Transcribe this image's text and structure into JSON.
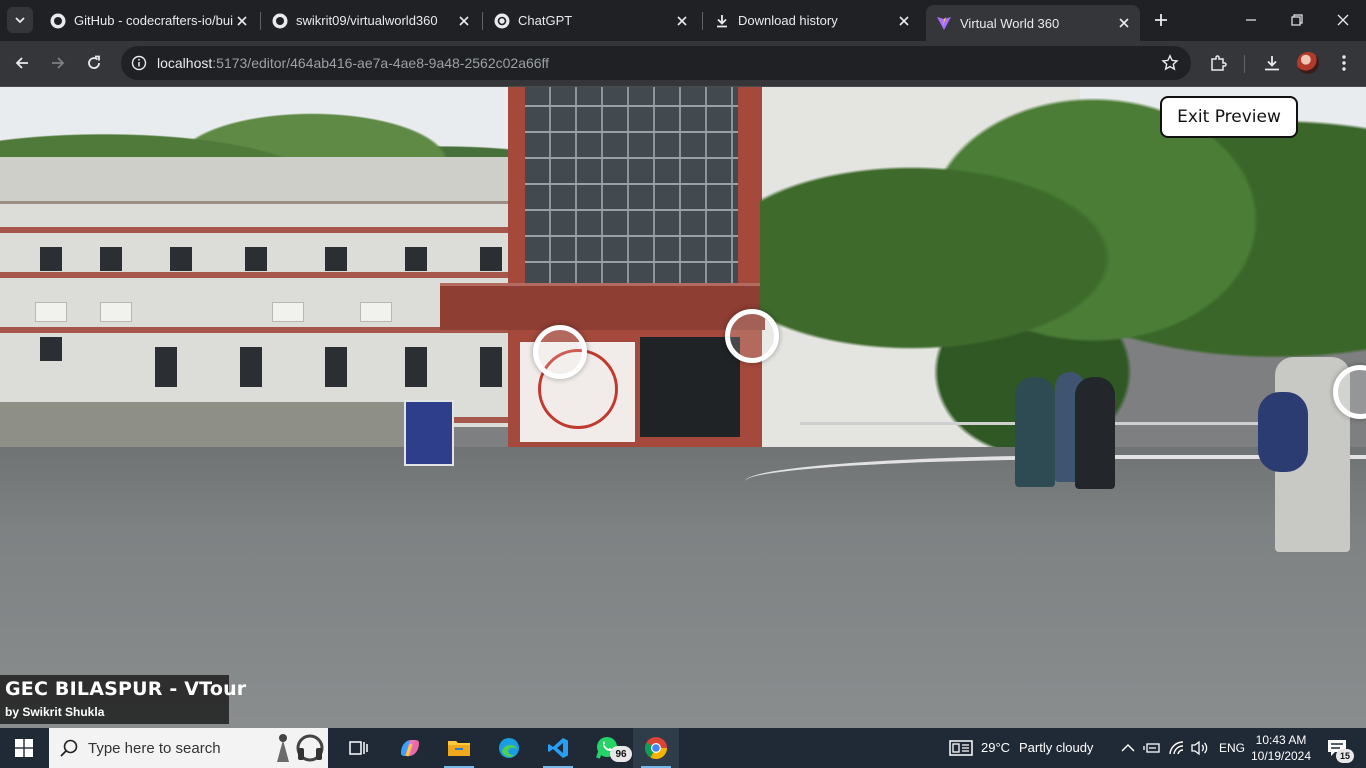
{
  "browser": {
    "tabs": [
      {
        "title": "GitHub - codecrafters-io/bui",
        "favicon": "github-icon",
        "active": false
      },
      {
        "title": "swikrit09/virtualworld360",
        "favicon": "github-icon",
        "active": false
      },
      {
        "title": "ChatGPT",
        "favicon": "chatgpt-icon",
        "active": false
      },
      {
        "title": "Download history",
        "favicon": "download-icon",
        "active": false
      },
      {
        "title": "Virtual World 360",
        "favicon": "vite-icon",
        "active": true
      }
    ],
    "url_host": "localhost",
    "url_path": ":5173/editor/464ab416-ae7a-4ae8-9a48-2562c02a66ff"
  },
  "viewer": {
    "exit_button": "Exit Preview",
    "tour_title": "GEC BILASPUR - VTour",
    "tour_author": "by Swikrit Shukla",
    "hotspots": 3
  },
  "taskbar": {
    "search_placeholder": "Type here to search",
    "whatsapp_badge": "96",
    "weather_temp": "29°C",
    "weather_text": "Partly cloudy",
    "language": "ENG",
    "time": "10:43 AM",
    "date": "10/19/2024",
    "notification_count": "15"
  },
  "colors": {
    "tab_strip": "#202124",
    "toolbar": "#35363a",
    "taskbar": "#1f2a36",
    "exit_button_bg": "#ffffff"
  }
}
